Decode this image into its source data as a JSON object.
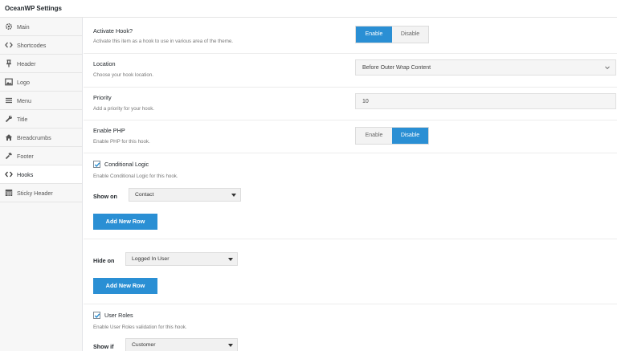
{
  "app": {
    "title": "OceanWP Settings"
  },
  "sidebar": {
    "items": [
      {
        "label": "Main",
        "icon": "gear-icon"
      },
      {
        "label": "Shortcodes",
        "icon": "code-icon"
      },
      {
        "label": "Header",
        "icon": "pin-icon"
      },
      {
        "label": "Logo",
        "icon": "image-icon"
      },
      {
        "label": "Menu",
        "icon": "menu-icon"
      },
      {
        "label": "Title",
        "icon": "wrench-icon"
      },
      {
        "label": "Breadcrumbs",
        "icon": "home-icon"
      },
      {
        "label": "Footer",
        "icon": "hammer-icon"
      },
      {
        "label": "Hooks",
        "icon": "code-icon"
      },
      {
        "label": "Sticky Header",
        "icon": "table-icon"
      }
    ],
    "active": "Hooks"
  },
  "main": {
    "activate_hook": {
      "label": "Activate Hook?",
      "desc": "Activate this item as a hook to use in various area of the theme.",
      "enable": "Enable",
      "disable": "Disable",
      "selected": "Enable"
    },
    "location": {
      "label": "Location",
      "desc": "Choose your hook location.",
      "value": "Before Outer Wrap Content"
    },
    "priority": {
      "label": "Priority",
      "desc": "Add a priority for your hook.",
      "value": "10"
    },
    "enable_php": {
      "label": "Enable PHP",
      "desc": "Enable PHP for this hook.",
      "enable": "Enable",
      "disable": "Disable",
      "selected": "Disable"
    },
    "conditional_logic": {
      "label": "Conditional Logic",
      "desc": "Enable Conditional Logic for this hook.",
      "checked": true,
      "show_on_label": "Show on",
      "show_on_value": "Contact",
      "add_row_1": "Add New Row",
      "hide_on_label": "Hide on",
      "hide_on_value": "Logged In User",
      "add_row_2": "Add New Row"
    },
    "user_roles": {
      "label": "User Roles",
      "desc": "Enable User Roles validation for this hook.",
      "checked": true,
      "show_if_label": "Show if",
      "show_if_value": "Customer"
    }
  },
  "colors": {
    "accent": "#2a8fd4",
    "sidebar_bg": "#f7f7f7",
    "border": "#e5e5e5"
  }
}
